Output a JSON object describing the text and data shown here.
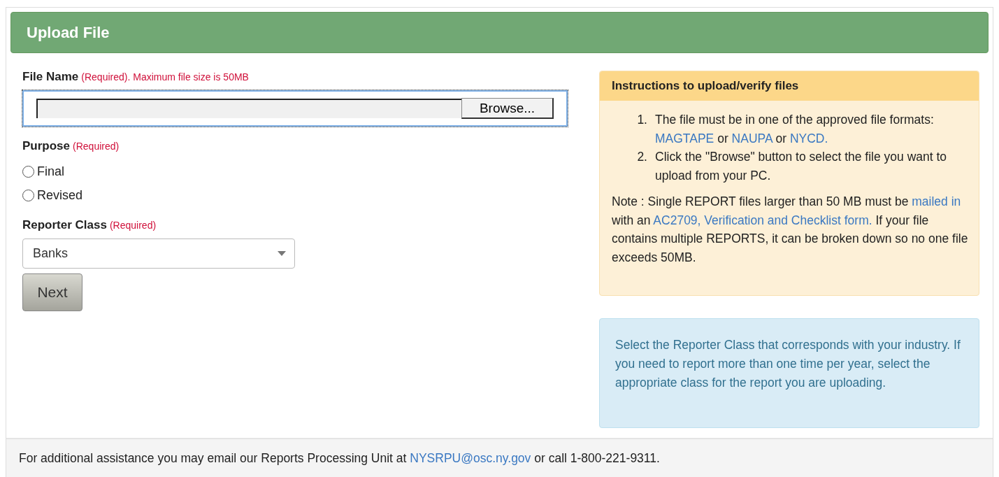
{
  "header": {
    "title": "Upload File"
  },
  "file_name": {
    "label": "File Name",
    "note": "(Required). Maximum file size is 50MB",
    "browse": "Browse..."
  },
  "purpose": {
    "label": "Purpose",
    "note": "(Required)",
    "options": [
      {
        "label": "Final",
        "selected": false
      },
      {
        "label": "Revised",
        "selected": false
      }
    ]
  },
  "reporter_class": {
    "label": "Reporter Class",
    "note": "(Required)",
    "value": "Banks"
  },
  "next_button": "Next",
  "instructions": {
    "title": "Instructions to upload/verify files",
    "steps": [
      [
        {
          "kind": "text",
          "text": "The file must be in one of the approved file formats: "
        },
        {
          "kind": "link",
          "text": "MAGTAPE"
        },
        {
          "kind": "text",
          "text": " or "
        },
        {
          "kind": "link",
          "text": "NAUPA"
        },
        {
          "kind": "text",
          "text": " or "
        },
        {
          "kind": "link",
          "text": "NYCD."
        }
      ],
      [
        {
          "kind": "text",
          "text": "Click the \"Browse\" button to select the file you want to upload from your PC."
        }
      ]
    ],
    "numbers": [
      "1.",
      "2."
    ],
    "note": [
      {
        "kind": "text",
        "text": "Note : Single REPORT files larger than 50 MB must be "
      },
      {
        "kind": "link",
        "text": "mailed in"
      },
      {
        "kind": "text",
        "text": " with an "
      },
      {
        "kind": "link",
        "text": "AC2709, Verification and Checklist form."
      },
      {
        "kind": "text",
        "text": " If your file contains multiple REPORTS, it can be broken down so no one file exceeds 50MB."
      }
    ]
  },
  "info": "Select the Reporter Class that corresponds with your industry. If you need to report more than one time per year, select the appropriate class for the report you are uploading.",
  "footer": [
    {
      "kind": "text",
      "text": "For additional assistance you may email our Reports Processing Unit at "
    },
    {
      "kind": "link",
      "text": "NYSRPU@osc.ny.gov"
    },
    {
      "kind": "text",
      "text": " or call 1-800-221-9311."
    }
  ]
}
